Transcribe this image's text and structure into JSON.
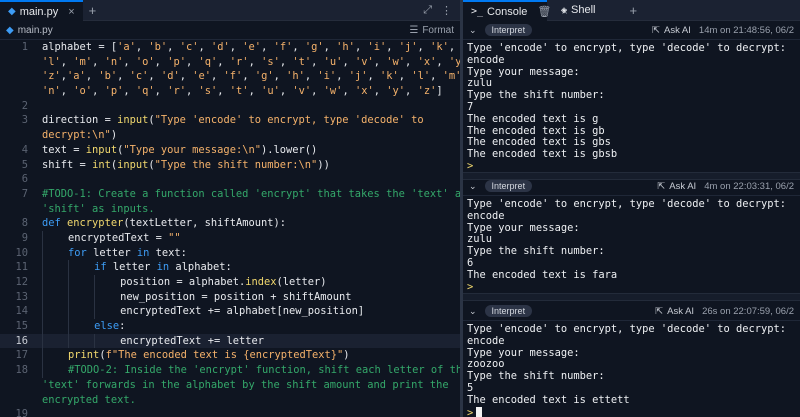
{
  "editor": {
    "tab_label": "main.py",
    "tab_close": "×",
    "tab_add": "+",
    "breadcrumb": "main.py",
    "format_label": "Format",
    "current_line": 16
  },
  "code_lines": [
    {
      "n": "1",
      "t": [
        [
          "v",
          "alphabet "
        ],
        [
          "p",
          "= ["
        ],
        [
          "s",
          "'a'"
        ],
        [
          "p",
          ", "
        ],
        [
          "s",
          "'b'"
        ],
        [
          "p",
          ", "
        ],
        [
          "s",
          "'c'"
        ],
        [
          "p",
          ", "
        ],
        [
          "s",
          "'d'"
        ],
        [
          "p",
          ", "
        ],
        [
          "s",
          "'e'"
        ],
        [
          "p",
          ", "
        ],
        [
          "s",
          "'f'"
        ],
        [
          "p",
          ", "
        ],
        [
          "s",
          "'g'"
        ],
        [
          "p",
          ", "
        ],
        [
          "s",
          "'h'"
        ],
        [
          "p",
          ", "
        ],
        [
          "s",
          "'i'"
        ],
        [
          "p",
          ", "
        ],
        [
          "s",
          "'j'"
        ],
        [
          "p",
          ", "
        ],
        [
          "s",
          "'k'"
        ],
        [
          "p",
          ","
        ]
      ]
    },
    {
      "n": "",
      "t": [
        [
          "s",
          "'l'"
        ],
        [
          "p",
          ", "
        ],
        [
          "s",
          "'m'"
        ],
        [
          "p",
          ", "
        ],
        [
          "s",
          "'n'"
        ],
        [
          "p",
          ", "
        ],
        [
          "s",
          "'o'"
        ],
        [
          "p",
          ", "
        ],
        [
          "s",
          "'p'"
        ],
        [
          "p",
          ", "
        ],
        [
          "s",
          "'q'"
        ],
        [
          "p",
          ", "
        ],
        [
          "s",
          "'r'"
        ],
        [
          "p",
          ", "
        ],
        [
          "s",
          "'s'"
        ],
        [
          "p",
          ", "
        ],
        [
          "s",
          "'t'"
        ],
        [
          "p",
          ", "
        ],
        [
          "s",
          "'u'"
        ],
        [
          "p",
          ", "
        ],
        [
          "s",
          "'v'"
        ],
        [
          "p",
          ", "
        ],
        [
          "s",
          "'w'"
        ],
        [
          "p",
          ", "
        ],
        [
          "s",
          "'x'"
        ],
        [
          "p",
          ", "
        ],
        [
          "s",
          "'y'"
        ],
        [
          "p",
          ","
        ]
      ]
    },
    {
      "n": "",
      "t": [
        [
          "s",
          "'z'"
        ],
        [
          "p",
          ","
        ],
        [
          "s",
          "'a'"
        ],
        [
          "p",
          ", "
        ],
        [
          "s",
          "'b'"
        ],
        [
          "p",
          ", "
        ],
        [
          "s",
          "'c'"
        ],
        [
          "p",
          ", "
        ],
        [
          "s",
          "'d'"
        ],
        [
          "p",
          ", "
        ],
        [
          "s",
          "'e'"
        ],
        [
          "p",
          ", "
        ],
        [
          "s",
          "'f'"
        ],
        [
          "p",
          ", "
        ],
        [
          "s",
          "'g'"
        ],
        [
          "p",
          ", "
        ],
        [
          "s",
          "'h'"
        ],
        [
          "p",
          ", "
        ],
        [
          "s",
          "'i'"
        ],
        [
          "p",
          ", "
        ],
        [
          "s",
          "'j'"
        ],
        [
          "p",
          ", "
        ],
        [
          "s",
          "'k'"
        ],
        [
          "p",
          ", "
        ],
        [
          "s",
          "'l'"
        ],
        [
          "p",
          ", "
        ],
        [
          "s",
          "'m'"
        ],
        [
          "p",
          ","
        ]
      ]
    },
    {
      "n": "",
      "t": [
        [
          "s",
          "'n'"
        ],
        [
          "p",
          ", "
        ],
        [
          "s",
          "'o'"
        ],
        [
          "p",
          ", "
        ],
        [
          "s",
          "'p'"
        ],
        [
          "p",
          ", "
        ],
        [
          "s",
          "'q'"
        ],
        [
          "p",
          ", "
        ],
        [
          "s",
          "'r'"
        ],
        [
          "p",
          ", "
        ],
        [
          "s",
          "'s'"
        ],
        [
          "p",
          ", "
        ],
        [
          "s",
          "'t'"
        ],
        [
          "p",
          ", "
        ],
        [
          "s",
          "'u'"
        ],
        [
          "p",
          ", "
        ],
        [
          "s",
          "'v'"
        ],
        [
          "p",
          ", "
        ],
        [
          "s",
          "'w'"
        ],
        [
          "p",
          ", "
        ],
        [
          "s",
          "'x'"
        ],
        [
          "p",
          ", "
        ],
        [
          "s",
          "'y'"
        ],
        [
          "p",
          ", "
        ],
        [
          "s",
          "'z'"
        ],
        [
          "p",
          "]"
        ]
      ]
    },
    {
      "n": "2",
      "t": []
    },
    {
      "n": "3",
      "t": [
        [
          "v",
          "direction "
        ],
        [
          "p",
          "= "
        ],
        [
          "f",
          "input"
        ],
        [
          "p",
          "("
        ],
        [
          "s",
          "\"Type 'encode' to encrypt, type 'decode' to"
        ]
      ]
    },
    {
      "n": "",
      "t": [
        [
          "s",
          "decrypt:\\n\""
        ],
        [
          "p",
          ")"
        ]
      ]
    },
    {
      "n": "4",
      "t": [
        [
          "v",
          "text "
        ],
        [
          "p",
          "= "
        ],
        [
          "f",
          "input"
        ],
        [
          "p",
          "("
        ],
        [
          "s",
          "\"Type your message:\\n\""
        ],
        [
          "p",
          ").lower()"
        ]
      ]
    },
    {
      "n": "5",
      "t": [
        [
          "v",
          "shift "
        ],
        [
          "p",
          "= "
        ],
        [
          "f",
          "int"
        ],
        [
          "p",
          "("
        ],
        [
          "f",
          "input"
        ],
        [
          "p",
          "("
        ],
        [
          "s",
          "\"Type the shift number:\\n\""
        ],
        [
          "p",
          "))"
        ]
      ]
    },
    {
      "n": "6",
      "t": []
    },
    {
      "n": "7",
      "t": [
        [
          "c",
          "#TODO-1: Create a function called 'encrypt' that takes the 'text' and"
        ]
      ]
    },
    {
      "n": "",
      "t": [
        [
          "c",
          "'shift' as inputs."
        ]
      ]
    },
    {
      "n": "8",
      "t": [
        [
          "k",
          "def "
        ],
        [
          "f",
          "encrypter"
        ],
        [
          "p",
          "(textLetter, shiftAmount):"
        ]
      ]
    },
    {
      "n": "9",
      "i": 1,
      "t": [
        [
          "v",
          "encryptedText "
        ],
        [
          "p",
          "= "
        ],
        [
          "s",
          "\"\""
        ]
      ]
    },
    {
      "n": "10",
      "i": 1,
      "t": [
        [
          "k",
          "for "
        ],
        [
          "v",
          "letter "
        ],
        [
          "k",
          "in "
        ],
        [
          "v",
          "text:"
        ]
      ]
    },
    {
      "n": "11",
      "i": 2,
      "t": [
        [
          "k",
          "if "
        ],
        [
          "v",
          "letter "
        ],
        [
          "k",
          "in "
        ],
        [
          "v",
          "alphabet:"
        ]
      ]
    },
    {
      "n": "12",
      "i": 3,
      "t": [
        [
          "v",
          "position "
        ],
        [
          "p",
          "= alphabet."
        ],
        [
          "f",
          "index"
        ],
        [
          "p",
          "(letter)"
        ]
      ]
    },
    {
      "n": "13",
      "i": 3,
      "t": [
        [
          "v",
          "new_position "
        ],
        [
          "p",
          "= position + shiftAmount"
        ]
      ]
    },
    {
      "n": "14",
      "i": 3,
      "t": [
        [
          "v",
          "encryptedText "
        ],
        [
          "p",
          "+= alphabet[new_position]"
        ]
      ]
    },
    {
      "n": "15",
      "i": 2,
      "t": [
        [
          "k",
          "else"
        ],
        [
          "p",
          ":"
        ]
      ]
    },
    {
      "n": "16",
      "i": 3,
      "t": [
        [
          "v",
          "encryptedText "
        ],
        [
          "p",
          "+= letter"
        ]
      ]
    },
    {
      "n": "17",
      "i": 1,
      "t": [
        [
          "f",
          "print"
        ],
        [
          "p",
          "("
        ],
        [
          "s",
          "f\"The encoded text is {encryptedText}\""
        ],
        [
          "p",
          ")"
        ]
      ]
    },
    {
      "n": "18",
      "i": 1,
      "t": [
        [
          "c",
          "#TODO-2: Inside the 'encrypt' function, shift each letter of the"
        ]
      ]
    },
    {
      "n": "",
      "t": [
        [
          "c",
          "'text' forwards in the alphabet by the shift amount and print the"
        ]
      ]
    },
    {
      "n": "",
      "t": [
        [
          "c",
          "encrypted text."
        ]
      ]
    },
    {
      "n": "19",
      "t": []
    }
  ],
  "console": {
    "tabs": [
      {
        "label": "Console",
        "icon": ">_"
      },
      {
        "label": "Shell",
        "icon": "◈"
      }
    ],
    "tab_add": "+",
    "runs": [
      {
        "pill": "Interpret",
        "ask_ai": "Ask AI",
        "timestamp": "14m on 21:48:56, 06/2",
        "output": "Type 'encode' to encrypt, type 'decode' to decrypt:\nencode\nType your message:\nzulu\nType the shift number:\n7\nThe encoded text is g\nThe encoded text is gb\nThe encoded text is gbs\nThe encoded text is gbsb",
        "cursor": false
      },
      {
        "pill": "Interpret",
        "ask_ai": "Ask AI",
        "timestamp": "4m on 22:03:31, 06/2",
        "output": "Type 'encode' to encrypt, type 'decode' to decrypt:\nencode\nType your message:\nzulu\nType the shift number:\n6\nThe encoded text is fara",
        "cursor": false
      },
      {
        "pill": "Interpret",
        "ask_ai": "Ask AI",
        "timestamp": "26s on 22:07:59, 06/2",
        "output": "Type 'encode' to encrypt, type 'decode' to decrypt:\nencode\nType your message:\nzoozoo\nType the shift number:\n5\nThe encoded text is ettett",
        "cursor": true
      }
    ],
    "prompt_symbol": ">"
  }
}
